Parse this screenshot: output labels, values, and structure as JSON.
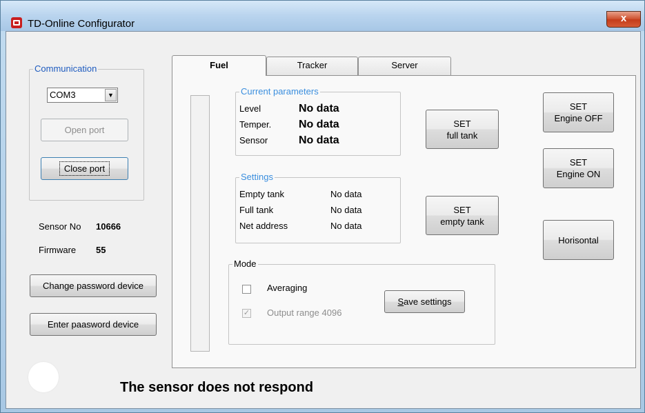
{
  "window": {
    "title": "TD-Online Configurator",
    "close_label": "x"
  },
  "communication": {
    "legend": "Communication",
    "port_value": "COM3",
    "open_port_label": "Open port",
    "close_port_label": "Close port"
  },
  "device": {
    "sensor_no_label": "Sensor No",
    "sensor_no_value": "10666",
    "firmware_label": "Firmware",
    "firmware_value": "55",
    "change_password_label": "Change password device",
    "enter_password_label": "Enter paasword device"
  },
  "tabs": [
    {
      "label": "Fuel",
      "active": true
    },
    {
      "label": "Tracker",
      "active": false
    },
    {
      "label": "Server",
      "active": false
    }
  ],
  "current_parameters": {
    "legend": "Current parameters",
    "rows": [
      {
        "label": "Level",
        "value": "No data"
      },
      {
        "label": "Temper.",
        "value": "No data"
      },
      {
        "label": "Sensor",
        "value": "No data"
      }
    ]
  },
  "settings": {
    "legend": "Settings",
    "rows": [
      {
        "label": "Empty tank",
        "value": "No data"
      },
      {
        "label": "Full tank",
        "value": "No data"
      },
      {
        "label": "Net address",
        "value": "No data"
      }
    ]
  },
  "mode": {
    "legend": "Mode",
    "averaging_label": "Averaging",
    "averaging_checked": false,
    "output_range_label": "Output range 4096",
    "output_range_checked": true,
    "save_settings_label": "Save settings"
  },
  "buttons": {
    "set_full_tank": "SET\nfull tank",
    "set_empty_tank": "SET\nempty tank",
    "set_engine_off": "SET\nEngine OFF",
    "set_engine_on": "SET\nEngine ON",
    "horisontal": "Horisontal"
  },
  "status": {
    "message": "The sensor does not respond"
  },
  "colors": {
    "legend_blue": "#1e5bbf",
    "close_button_red": "#c43c1a"
  }
}
